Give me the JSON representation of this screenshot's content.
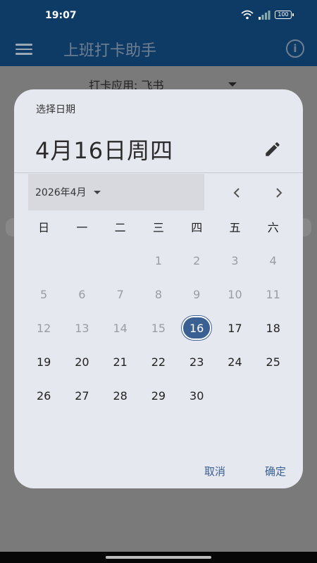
{
  "status": {
    "time": "19:07",
    "battery": "100"
  },
  "app": {
    "title": "上班打卡助手",
    "punch_label": "打卡应用: 飞书"
  },
  "dialog": {
    "label": "选择日期",
    "headline": "4月16日周四",
    "month_label": "2026年4月",
    "weekdays": [
      "日",
      "一",
      "二",
      "三",
      "四",
      "五",
      "六"
    ],
    "weeks": [
      [
        "",
        "",
        "",
        "1",
        "2",
        "3",
        "4"
      ],
      [
        "5",
        "6",
        "7",
        "8",
        "9",
        "10",
        "11"
      ],
      [
        "12",
        "13",
        "14",
        "15",
        "16",
        "17",
        "18"
      ],
      [
        "19",
        "20",
        "21",
        "22",
        "23",
        "24",
        "25"
      ],
      [
        "26",
        "27",
        "28",
        "29",
        "30",
        "",
        ""
      ]
    ],
    "selected_day": "16",
    "cancel_label": "取消",
    "confirm_label": "确定"
  },
  "colors": {
    "app_bar": "#0e3a66",
    "dialog_bg": "#e6e8ef",
    "accent": "#3a5f93"
  },
  "icons": [
    "menu-icon",
    "info-icon",
    "edit-icon",
    "chevron-left-icon",
    "chevron-right-icon",
    "wifi-icon",
    "signal-icon",
    "battery-icon"
  ]
}
